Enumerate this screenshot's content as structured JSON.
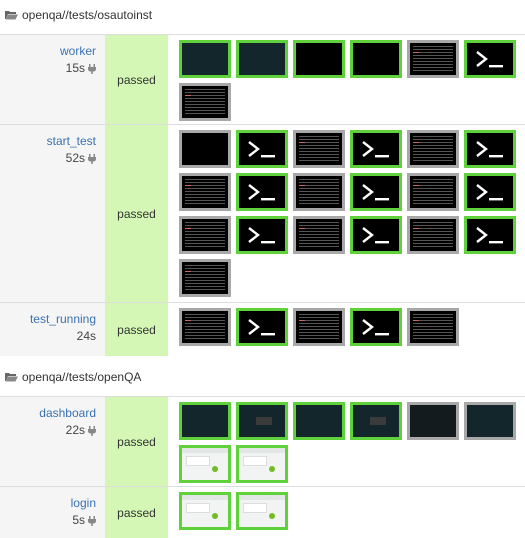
{
  "groups": [
    {
      "title": "openqa//tests/osautoinst",
      "rows": [
        {
          "name": "worker",
          "duration": "15s",
          "result": "passed",
          "thumbs": [
            {
              "kind": "teal",
              "frame": "green"
            },
            {
              "kind": "teal",
              "frame": "green"
            },
            {
              "kind": "black",
              "frame": "green"
            },
            {
              "kind": "black",
              "frame": "green"
            },
            {
              "kind": "console",
              "frame": "gray"
            },
            {
              "kind": "term",
              "frame": "green"
            },
            {
              "kind": "console",
              "frame": "gray"
            }
          ]
        },
        {
          "name": "start_test",
          "duration": "52s",
          "result": "passed",
          "thumbs": [
            {
              "kind": "black",
              "frame": "gray"
            },
            {
              "kind": "term",
              "frame": "green"
            },
            {
              "kind": "console",
              "frame": "gray"
            },
            {
              "kind": "term",
              "frame": "green"
            },
            {
              "kind": "console",
              "frame": "gray"
            },
            {
              "kind": "term",
              "frame": "green"
            },
            {
              "kind": "console",
              "frame": "gray"
            },
            {
              "kind": "term",
              "frame": "green"
            },
            {
              "kind": "console",
              "frame": "gray"
            },
            {
              "kind": "term",
              "frame": "green"
            },
            {
              "kind": "console",
              "frame": "gray"
            },
            {
              "kind": "term",
              "frame": "green"
            },
            {
              "kind": "console",
              "frame": "gray"
            },
            {
              "kind": "term",
              "frame": "green"
            },
            {
              "kind": "console",
              "frame": "gray"
            },
            {
              "kind": "term",
              "frame": "green"
            },
            {
              "kind": "console",
              "frame": "gray"
            },
            {
              "kind": "term",
              "frame": "green"
            },
            {
              "kind": "console",
              "frame": "gray"
            }
          ]
        },
        {
          "name": "test_running",
          "duration": "24s",
          "result": "passed",
          "thumbs": [
            {
              "kind": "console",
              "frame": "gray"
            },
            {
              "kind": "term",
              "frame": "green"
            },
            {
              "kind": "console",
              "frame": "gray"
            },
            {
              "kind": "term",
              "frame": "green"
            },
            {
              "kind": "console",
              "frame": "gray"
            }
          ]
        }
      ]
    },
    {
      "title": "openqa//tests/openQA",
      "rows": [
        {
          "name": "dashboard",
          "duration": "22s",
          "result": "passed",
          "thumbs": [
            {
              "kind": "teal",
              "frame": "green"
            },
            {
              "kind": "darkbox",
              "frame": "green"
            },
            {
              "kind": "teal",
              "frame": "green"
            },
            {
              "kind": "darkbox",
              "frame": "green"
            },
            {
              "kind": "dark",
              "frame": "gray"
            },
            {
              "kind": "teal",
              "frame": "gray"
            },
            {
              "kind": "web",
              "frame": "green"
            },
            {
              "kind": "web",
              "frame": "green"
            }
          ]
        },
        {
          "name": "login",
          "duration": "5s",
          "result": "passed",
          "thumbs": [
            {
              "kind": "web",
              "frame": "green"
            },
            {
              "kind": "web",
              "frame": "green"
            }
          ]
        }
      ]
    }
  ],
  "colors": {
    "passed_bg": "#d4f7b6",
    "frame_ok": "#5fd13a",
    "frame_neutral": "#a8a8a8",
    "link": "#3a72b3"
  },
  "icons": {
    "group": "folder-open-icon",
    "duration": "plug-icon"
  }
}
